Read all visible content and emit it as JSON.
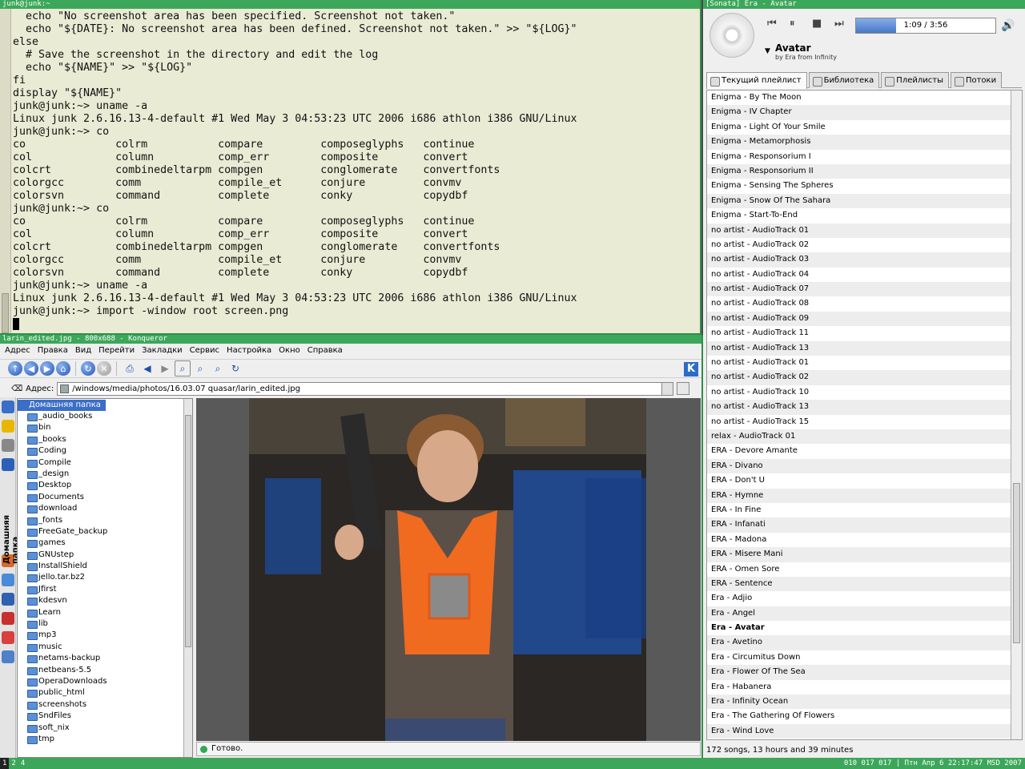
{
  "terminal": {
    "title": "junk@junk:~",
    "lines": [
      "  echo \"No screenshot area has been specified. Screenshot not taken.\"",
      "  echo \"${DATE}: No screenshot area has been defined. Screenshot not taken.\" >> \"${LOG}\"",
      "else",
      "  # Save the screenshot in the directory and edit the log",
      "  echo \"${NAME}\" >> \"${LOG}\"",
      "fi",
      "display \"${NAME}\"",
      "junk@junk:~> uname -a",
      "Linux junk 2.6.16.13-4-default #1 Wed May 3 04:53:23 UTC 2006 i686 athlon i386 GNU/Linux",
      "junk@junk:~> co",
      "co              colrm           compare         composeglyphs   continue",
      "col             column          comp_err        composite       convert",
      "colcrt          combinedeltarpm compgen         conglomerate    convertfonts",
      "colorgcc        comm            compile_et      conjure         convmv",
      "colorsvn        command         complete        conky           copydbf",
      "junk@junk:~> co",
      "co              colrm           compare         composeglyphs   continue",
      "col             column          comp_err        composite       convert",
      "colcrt          combinedeltarpm compgen         conglomerate    convertfonts",
      "colorgcc        comm            compile_et      conjure         convmv",
      "colorsvn        command         complete        conky           copydbf",
      "junk@junk:~> uname -a",
      "Linux junk 2.6.16.13-4-default #1 Wed May 3 04:53:23 UTC 2006 i686 athlon i386 GNU/Linux",
      "junk@junk:~> import -window root screen.png"
    ]
  },
  "konqueror": {
    "title": "larin_edited.jpg - 800x688 - Konqueror",
    "menu": [
      "Адрес",
      "Правка",
      "Вид",
      "Перейти",
      "Закладки",
      "Сервис",
      "Настройка",
      "Окно",
      "Справка"
    ],
    "address_label": "Адрес:",
    "address": "/windows/media/photos/16.03.07 quasar/larin_edited.jpg",
    "side_label": "Домашняя папка",
    "tree_root": "Домашняя папка",
    "tree": [
      "_audio_books",
      "bin",
      "_books",
      "Coding",
      "Compile",
      "_design",
      "Desktop",
      "Documents",
      "download",
      "_fonts",
      "FreeGate_backup",
      "games",
      "GNUstep",
      "InstallShield",
      "jello.tar.bz2",
      "Jfirst",
      "kdesvn",
      "Learn",
      "lib",
      "mp3",
      "music",
      "netams-backup",
      "netbeans-5.5",
      "OperaDownloads",
      "public_html",
      "screenshots",
      "SndFiles",
      "soft_nix",
      "tmp"
    ],
    "status": "Готово."
  },
  "sonata": {
    "title": "[Sonata] Era - Avatar",
    "song": "Avatar",
    "by": "by Era from Infinity",
    "time": "1:09 / 3:56",
    "progress": 0.29,
    "tabs": [
      "Текущий плейлист",
      "Библиотека",
      "Плейлисты",
      "Потоки"
    ],
    "playlist": [
      "Enigma - By The Moon",
      "Enigma - IV Chapter",
      "Enigma - Light Of Your Smile",
      "Enigma - Metamorphosis",
      "Enigma - Responsorium I",
      "Enigma - Responsorium II",
      "Enigma - Sensing The Spheres",
      "Enigma - Snow Of The Sahara",
      "Enigma - Start-To-End",
      "no artist - AudioTrack 01",
      "no artist - AudioTrack 02",
      "no artist - AudioTrack 03",
      "no artist - AudioTrack 04",
      "no artist - AudioTrack 07",
      "no artist - AudioTrack 08",
      "no artist - AudioTrack 09",
      "no artist - AudioTrack 11",
      "no artist - AudioTrack 13",
      "no artist - AudioTrack 01",
      "no artist - AudioTrack 02",
      "no artist - AudioTrack 10",
      "no artist - AudioTrack 13",
      "no artist - AudioTrack 15",
      "relax - AudioTrack 01",
      "ERA - Devore Amante",
      "ERA - Divano",
      "ERA - Don't U",
      "ERA - Hymne",
      "ERA - In Fine",
      "ERA - Infanati",
      "ERA - Madona",
      "ERA - Misere Mani",
      "ERA - Omen Sore",
      "ERA - Sentence",
      "Era - Adjio",
      "Era - Angel",
      "Era - Avatar",
      "Era - Avetino",
      "Era - Circumitus Down",
      "Era - Flower Of The Sea",
      "Era - Habanera",
      "Era - Infinity Ocean",
      "Era - The Gathering Of Flowers",
      "Era - Wind Love"
    ],
    "current": "Era - Avatar",
    "stats": "172 songs, 13 hours and 39 minutes"
  },
  "taskbar": {
    "desktops": [
      "1",
      "2",
      "4"
    ],
    "clock": "010 017 017 | Птн Апр 6 22:17:47 MSD 2007"
  }
}
